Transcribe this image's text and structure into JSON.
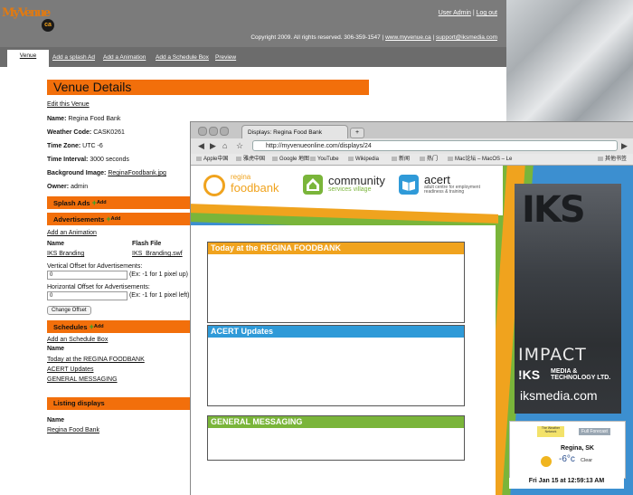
{
  "admin": {
    "logo_text": "MyVenue",
    "logo_badge": "ca",
    "top_links": [
      "User Admin",
      "Log out"
    ],
    "copyright": "Copyright 2009. All rights reserved. 306-359-1547 |",
    "copyright_links": [
      "www.myvenue.ca",
      "support@iksmedia.com"
    ],
    "nav_tabs": [
      "Venue",
      "Add a splash Ad",
      "Add a Animation",
      "Add a Schedule Box",
      "Preview"
    ],
    "page_title": "Venue Details",
    "edit_link": "Edit this Venue",
    "fields": {
      "name_label": "Name:",
      "name_value": "Regina Food Bank",
      "weather_label": "Weather Code:",
      "weather_value": "CASK0261",
      "tz_label": "Time Zone:",
      "tz_value": "UTC -6",
      "interval_label": "Time Interval:",
      "interval_value": "3000 seconds",
      "bg_label": "Background Image:",
      "bg_value": "ReginaFoodbank.jpg",
      "owner_label": "Owner:",
      "owner_value": "admin"
    },
    "splash_ads_title": "Splash Ads",
    "add_small": "Add",
    "ads_title": "Advertisements",
    "add_animation_link": "Add an Animation",
    "ads_table_headers": [
      "Name",
      "Flash File"
    ],
    "ads_rows": [
      {
        "name": "IKS Branding",
        "file": "IKS_Branding.swf"
      }
    ],
    "vertical_offset_label": "Vertical Offset for Advertisements:",
    "vertical_offset_value": "0",
    "vertical_offset_hint": "(Ex: -1 for 1 pixel up)",
    "horizontal_offset_label": "Horizontal Offset for Advertisements:",
    "horizontal_offset_value": "0",
    "horizontal_offset_hint": "(Ex: -1 for 1 pixel left)",
    "change_offset_button": "Change Offset",
    "schedules_title": "Schedules",
    "add_schedule_link": "Add an Schedule Box",
    "schedules_header": "Name",
    "schedules": [
      "Today at the REGINA FOODBANK",
      "ACERT Updates",
      "GENERAL MESSAGING"
    ],
    "listing_title": "Listing displays",
    "listing_header": "Name",
    "listing": [
      "Regina Food Bank"
    ]
  },
  "browser": {
    "tab_title": "Displays: Regina Food Bank",
    "url": "http://myvenueonline.com/displays/24",
    "bookmarks": [
      "Apple中国",
      "雅虎中国",
      "Google 地图",
      "YouTube",
      "Wikipedia",
      "新闻",
      "热门",
      "Mac论坛 – MacOS – Le",
      "其他书签"
    ]
  },
  "display": {
    "logos": {
      "regina_top": "regina",
      "regina_main": "foodbank",
      "community_main": "community",
      "community_sub": "services village",
      "acert_main": "acert",
      "acert_sub": "adult centre for employment readiness & training"
    },
    "panels": [
      {
        "title": "Today at the REGINA FOODBANK",
        "color": "#f0a31e"
      },
      {
        "title": "ACERT Updates",
        "color": "#2f9ad8"
      },
      {
        "title": "GENERAL MESSAGING",
        "color": "#7ab53a"
      }
    ],
    "ad": {
      "big_text": "IKS",
      "impact": "IMPACT",
      "iks": "!KS",
      "media_line1": "MEDIA &",
      "media_line2": "TECHNOLOGY LTD.",
      "site": "iksmedia.com"
    },
    "weather": {
      "brand": "The Weather Network",
      "forecast_button": "Full Forecast",
      "city": "Regina, SK",
      "temp": "-6°c",
      "condition": "Clear"
    },
    "datetime": "Fri Jan 15 at 12:59:13 AM"
  },
  "colors": {
    "orange": "#f26f0b",
    "nav_gray": "#7b7b7b",
    "display_blue": "#3c8fd0",
    "display_green": "#7ab53a",
    "display_orange": "#f0a31e"
  }
}
